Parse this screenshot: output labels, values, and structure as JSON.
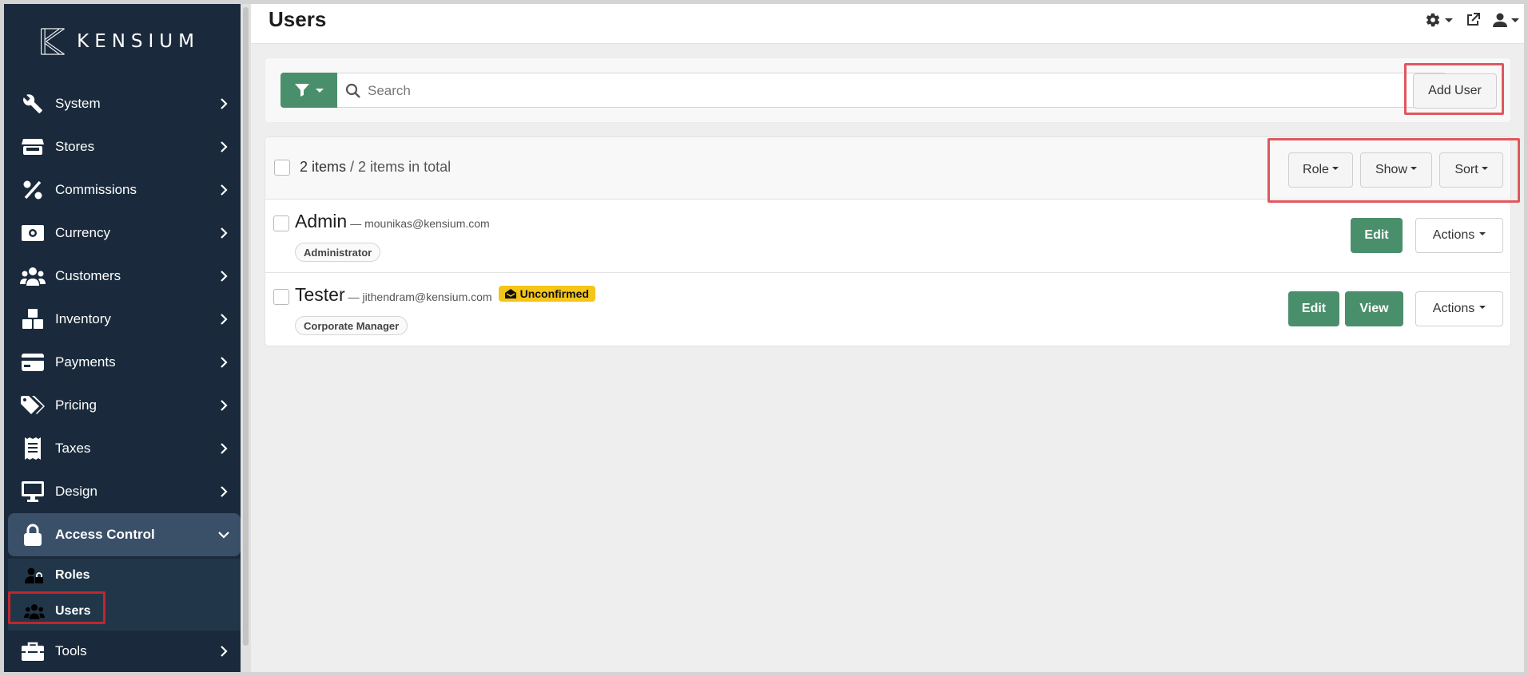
{
  "brand": {
    "name": "KENSIUM"
  },
  "sidebar": {
    "items": [
      {
        "label": "System",
        "icon": "wrench-icon"
      },
      {
        "label": "Stores",
        "icon": "store-icon"
      },
      {
        "label": "Commissions",
        "icon": "percent-icon"
      },
      {
        "label": "Currency",
        "icon": "money-bill-icon"
      },
      {
        "label": "Customers",
        "icon": "users-icon"
      },
      {
        "label": "Inventory",
        "icon": "boxes-icon"
      },
      {
        "label": "Payments",
        "icon": "credit-card-icon"
      },
      {
        "label": "Pricing",
        "icon": "tags-icon"
      },
      {
        "label": "Taxes",
        "icon": "receipt-icon"
      },
      {
        "label": "Design",
        "icon": "desktop-icon"
      },
      {
        "label": "Access Control",
        "icon": "lock-icon",
        "expanded": true
      },
      {
        "label": "Tools",
        "icon": "toolbox-icon"
      }
    ],
    "subitems": [
      {
        "label": "Roles",
        "icon": "user-lock-icon"
      },
      {
        "label": "Users",
        "icon": "users-icon",
        "active": true
      }
    ]
  },
  "header": {
    "title": "Users",
    "icons": [
      "gear-icon",
      "external-link-icon",
      "user-icon"
    ]
  },
  "search": {
    "placeholder": "Search",
    "value": ""
  },
  "toolbar": {
    "add_user_label": "Add User"
  },
  "list": {
    "count_label": "2 items",
    "total_label": "/ 2 items in total",
    "role_label": "Role",
    "show_label": "Show",
    "sort_label": "Sort",
    "rows": [
      {
        "name": "Admin",
        "email": "— mounikas@kensium.com",
        "role": "Administrator",
        "badge": "",
        "edit_label": "Edit",
        "actions_label": "Actions"
      },
      {
        "name": "Tester",
        "email": "— jithendram@kensium.com",
        "role": "Corporate Manager",
        "badge": "Unconfirmed",
        "edit_label": "Edit",
        "view_label": "View",
        "actions_label": "Actions"
      }
    ]
  },
  "colors": {
    "sidebar_bg": "#1a2a3c",
    "accent_green": "#4a8f6b",
    "highlight_red": "#e0575e",
    "badge_yellow": "#f5c518"
  }
}
